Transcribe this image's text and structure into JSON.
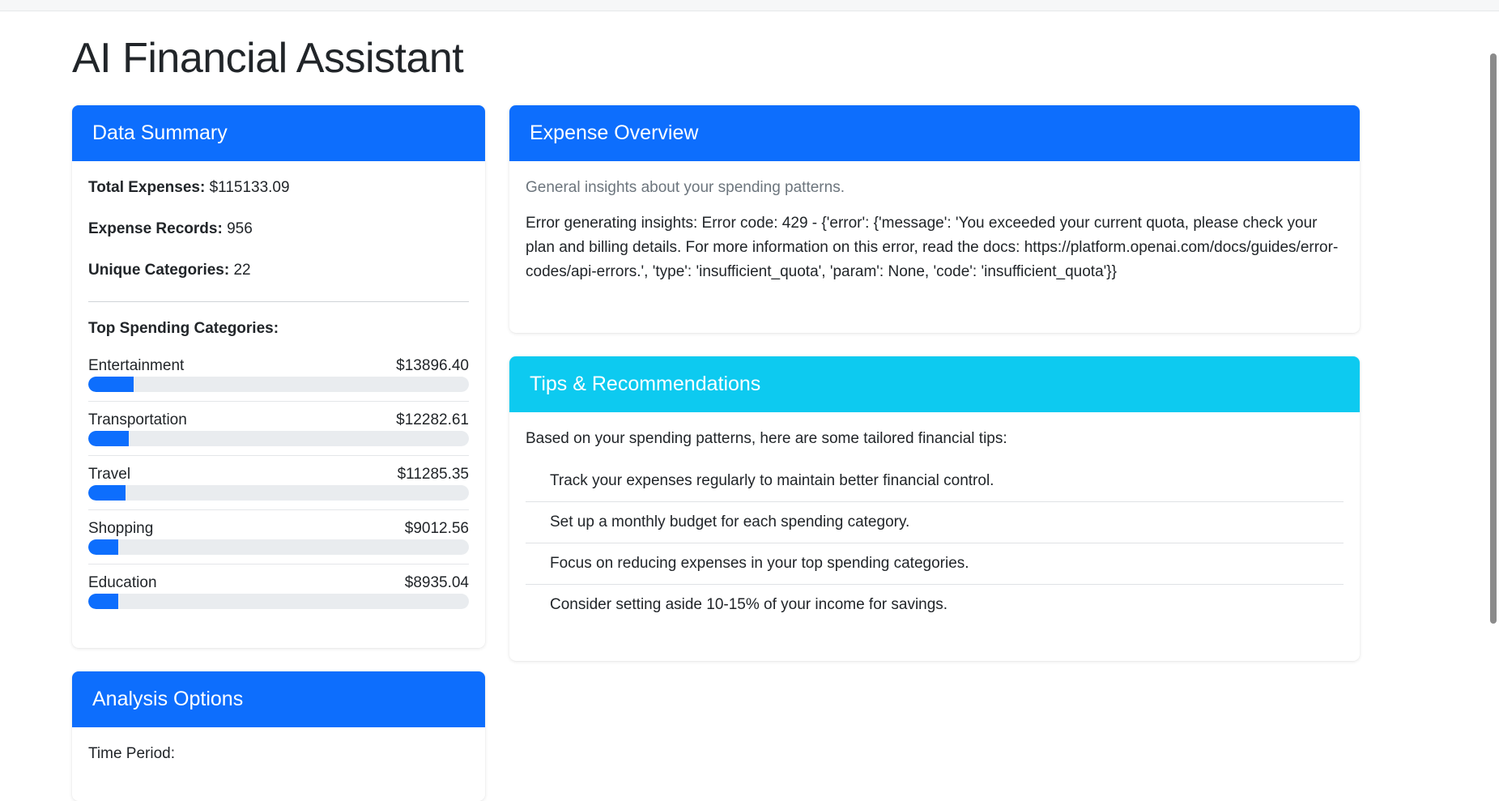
{
  "page_title": "AI Financial Assistant",
  "summary": {
    "header": "Data Summary",
    "total_label": "Total Expenses:",
    "total_value": "$115133.09",
    "records_label": "Expense Records:",
    "records_value": "956",
    "unique_label": "Unique Categories:",
    "unique_value": "22",
    "top_label": "Top Spending Categories:",
    "categories": [
      {
        "name": "Entertainment",
        "amount": "$13896.40",
        "percent": 12
      },
      {
        "name": "Transportation",
        "amount": "$12282.61",
        "percent": 10.7
      },
      {
        "name": "Travel",
        "amount": "$11285.35",
        "percent": 9.8
      },
      {
        "name": "Shopping",
        "amount": "$9012.56",
        "percent": 7.8
      },
      {
        "name": "Education",
        "amount": "$8935.04",
        "percent": 7.8
      }
    ]
  },
  "overview": {
    "header": "Expense Overview",
    "subtitle": "General insights about your spending patterns.",
    "error": "Error generating insights: Error code: 429 - {'error': {'message': 'You exceeded your current quota, please check your plan and billing details. For more information on this error, read the docs: https://platform.openai.com/docs/guides/error-codes/api-errors.', 'type': 'insufficient_quota', 'param': None, 'code': 'insufficient_quota'}}"
  },
  "tips": {
    "header": "Tips & Recommendations",
    "intro": "Based on your spending patterns, here are some tailored financial tips:",
    "items": [
      "Track your expenses regularly to maintain better financial control.",
      "Set up a monthly budget for each spending category.",
      "Focus on reducing expenses in your top spending categories.",
      "Consider setting aside 10-15% of your income for savings."
    ]
  },
  "analysis": {
    "header": "Analysis Options",
    "time_period_label": "Time Period:"
  },
  "colors": {
    "primary": "#0d6efd",
    "info": "#0dcaf0",
    "bar_track": "#e9ecef"
  }
}
